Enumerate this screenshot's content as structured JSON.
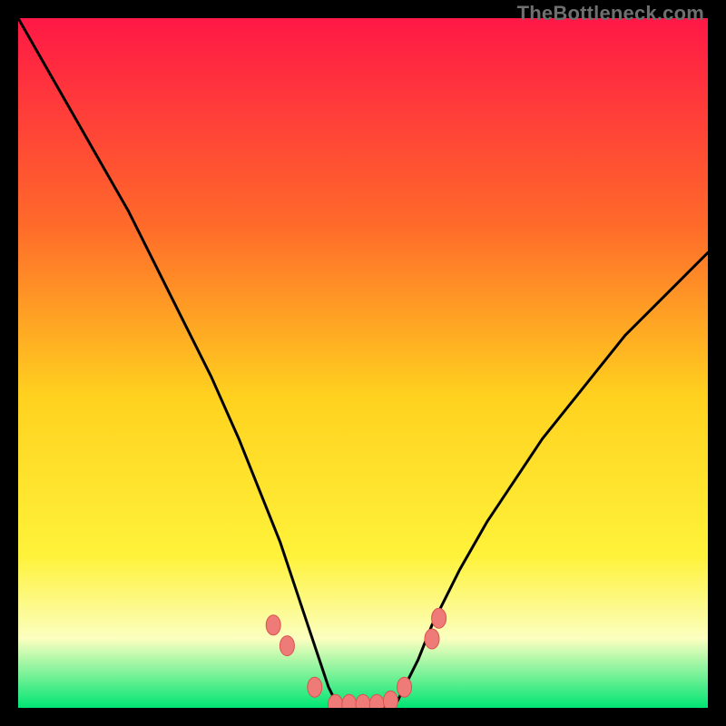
{
  "watermark": "TheBottleneck.com",
  "colors": {
    "bg": "#000000",
    "grad_top": "#ff1846",
    "grad_mid_upper": "#ff6a2a",
    "grad_mid": "#ffd21f",
    "grad_yellow": "#fff23a",
    "grad_pale": "#fbffc0",
    "grad_green": "#00e574",
    "curve": "#000000",
    "marker_fill": "#ef7b78",
    "marker_stroke": "#d9534f"
  },
  "chart_data": {
    "type": "line",
    "title": "",
    "xlabel": "",
    "ylabel": "",
    "xlim": [
      0,
      100
    ],
    "ylim": [
      0,
      100
    ],
    "grid": false,
    "legend": false,
    "series": [
      {
        "name": "bottleneck-curve",
        "x": [
          0,
          4,
          8,
          12,
          16,
          20,
          24,
          28,
          32,
          36,
          38,
          40,
          42,
          44,
          45,
          46,
          47,
          48,
          50,
          52,
          54,
          55,
          56,
          58,
          60,
          64,
          68,
          72,
          76,
          80,
          84,
          88,
          92,
          96,
          100
        ],
        "y": [
          100,
          93,
          86,
          79,
          72,
          64,
          56,
          48,
          39,
          29,
          24,
          18,
          12,
          6,
          3,
          1,
          0,
          0,
          0,
          0,
          0,
          1,
          3,
          7,
          12,
          20,
          27,
          33,
          39,
          44,
          49,
          54,
          58,
          62,
          66
        ]
      }
    ],
    "markers": [
      {
        "x": 37,
        "y": 12
      },
      {
        "x": 39,
        "y": 9
      },
      {
        "x": 43,
        "y": 3
      },
      {
        "x": 46,
        "y": 0.5
      },
      {
        "x": 48,
        "y": 0.5
      },
      {
        "x": 50,
        "y": 0.5
      },
      {
        "x": 52,
        "y": 0.5
      },
      {
        "x": 54,
        "y": 1
      },
      {
        "x": 56,
        "y": 3
      },
      {
        "x": 60,
        "y": 10
      },
      {
        "x": 61,
        "y": 13
      }
    ]
  }
}
